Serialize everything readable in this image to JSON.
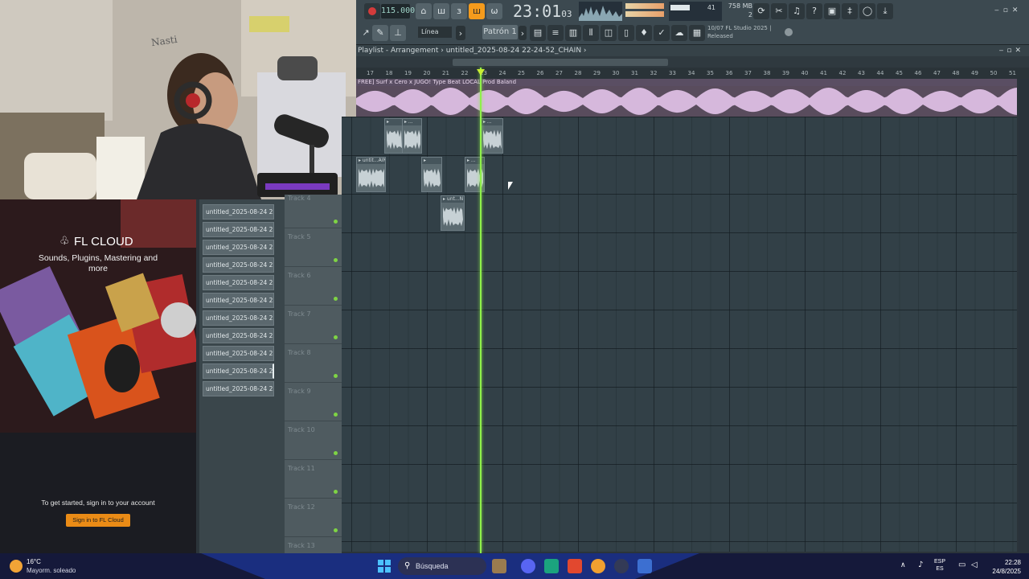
{
  "toolbar": {
    "tempo": "115.000",
    "time_main": "23:01",
    "time_sub": "03",
    "cpu_value": "41",
    "memory": "758 MB",
    "memory_sub": "2",
    "pattern": "Patrón 1",
    "snap": "Línea",
    "hint_line1": "10/07  FL Studio 2025 |",
    "hint_line2": "Released",
    "accent_color": "#f59b1c"
  },
  "playlist": {
    "title": "Playlist - Arrangement",
    "breadcrumb": "untitled_2025-08-24 22-24-52_CHAIN",
    "ruler": [
      "17",
      "18",
      "19",
      "20",
      "21",
      "22",
      "23",
      "24",
      "25",
      "26",
      "27",
      "28",
      "29",
      "30",
      "31",
      "32",
      "33",
      "34",
      "35",
      "36",
      "37",
      "38",
      "39",
      "40",
      "41",
      "42",
      "43",
      "44",
      "45",
      "46",
      "47",
      "48",
      "49",
      "50",
      "51"
    ],
    "main_clip_label": "FREE] Surf x Cero x JUGO! Type Beat  LOCAL  Prod Baland",
    "clips": [
      {
        "label": "▸"
      },
      {
        "label": "▸ ..."
      },
      {
        "label": "▸ ..."
      },
      {
        "label": "▸ untit...AIN"
      },
      {
        "label": "▸"
      },
      {
        "label": "▸ ..."
      },
      {
        "label": "▸ unt...N"
      }
    ],
    "tracks": [
      "Track 4",
      "Track 5",
      "Track 6",
      "Track 7",
      "Track 8",
      "Track 9",
      "Track 10",
      "Track 11",
      "Track 12",
      "Track 13"
    ]
  },
  "browser": {
    "items": [
      "untitled_2025-08-24 22-...",
      "untitled_2025-08-24 22-...",
      "untitled_2025-08-24 22-...",
      "untitled_2025-08-24 22-...",
      "untitled_2025-08-24 22-...",
      "untitled_2025-08-24 22-...",
      "untitled_2025-08-24 22-...",
      "untitled_2025-08-24 22-...",
      "untitled_2025-08-24 22-...",
      "untitled_2025-08-24 22-...",
      "untitled_2025-08-24 22-..."
    ]
  },
  "cloud": {
    "logo": "FL CLOUD",
    "subtitle": "Sounds, Plugins, Mastering and more",
    "cta_text": "To get started, sign in to your account",
    "button": "Sign in to FL Cloud",
    "button_color": "#ea8b16"
  },
  "webcam": {
    "wall_writing": "Nasti"
  },
  "taskbar": {
    "weather_temp": "16°C",
    "weather_desc": "Mayorm. soleado",
    "search_placeholder": "Búsqueda",
    "lang_top": "ESP",
    "lang_bottom": "ES",
    "time": "22:28",
    "date": "24/8/2025"
  }
}
